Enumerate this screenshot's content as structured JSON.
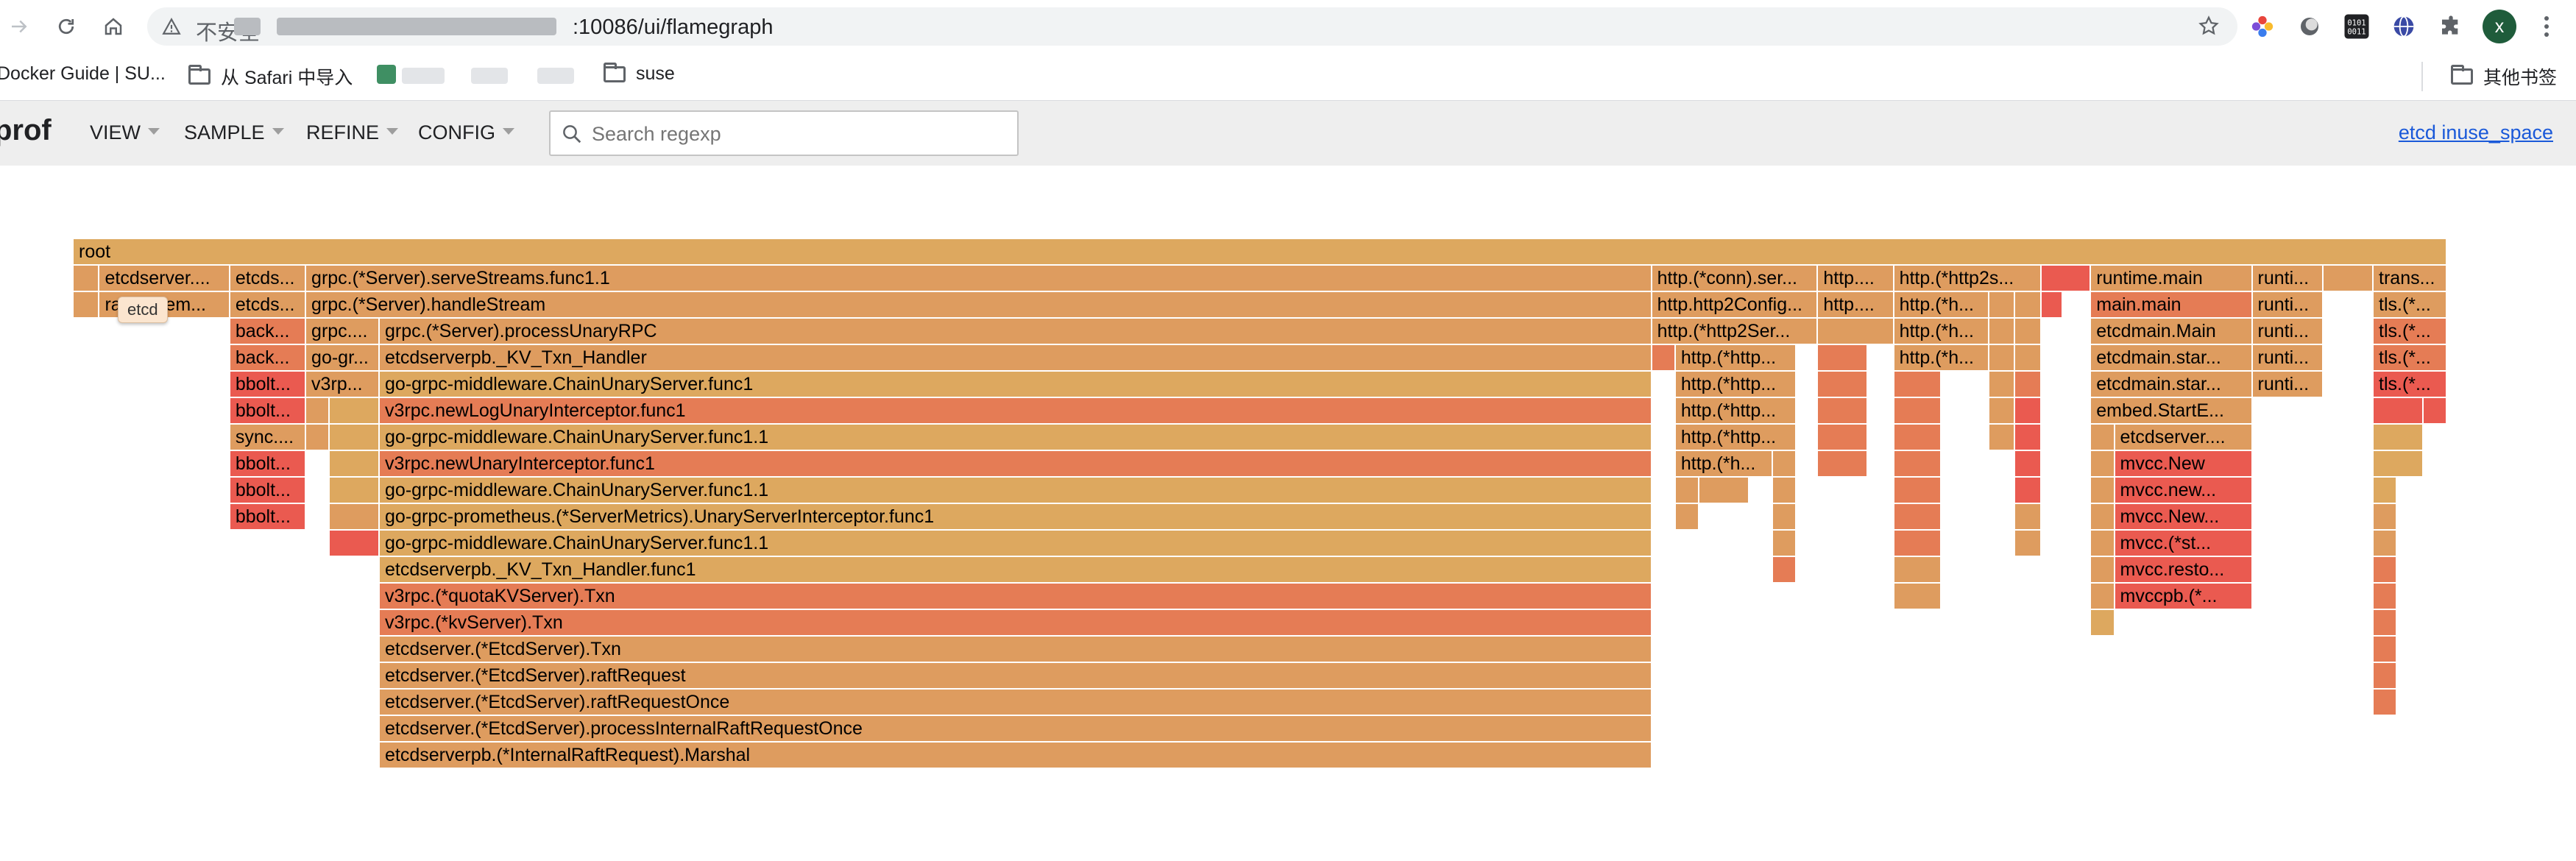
{
  "browser": {
    "insecure_label": "不安全",
    "url_suffix": ":10086/ui/flamegraph",
    "avatar_letter": "x"
  },
  "bookmarks": {
    "items": [
      "Docker Guide | SU...",
      "从 Safari 中导入",
      "suse"
    ],
    "other": "其他书签"
  },
  "pprof": {
    "logo": "prof",
    "menus": [
      "VIEW",
      "SAMPLE",
      "REFINE",
      "CONFIG"
    ],
    "search_placeholder": "Search regexp",
    "profile_link": "etcd inuse_space"
  },
  "tooltip": "etcd",
  "colors": {
    "tan": "#dda85f",
    "orange": "#de9c5f",
    "dark_orange": "#e57c55",
    "red": "#ea5a50",
    "link": "#1a59d9"
  },
  "flamegraph": {
    "frames": [
      {
        "d": 0,
        "s": 0,
        "e": 1000,
        "t": "root",
        "c": "tan"
      },
      {
        "d": 1,
        "s": 0,
        "e": 11,
        "t": "",
        "c": "orange"
      },
      {
        "d": 1,
        "s": 11,
        "e": 66,
        "t": "etcdserver....",
        "c": "orange"
      },
      {
        "d": 1,
        "s": 66,
        "e": 98,
        "t": "etcds...",
        "c": "orange"
      },
      {
        "d": 1,
        "s": 98,
        "e": 665,
        "t": "grpc.(*Server).serveStreams.func1.1",
        "c": "orange"
      },
      {
        "d": 1,
        "s": 665,
        "e": 735,
        "t": "http.(*conn).ser...",
        "c": "orange"
      },
      {
        "d": 1,
        "s": 735,
        "e": 767,
        "t": "http....",
        "c": "orange"
      },
      {
        "d": 1,
        "s": 767,
        "e": 829,
        "t": "http.(*http2s...",
        "c": "orange"
      },
      {
        "d": 1,
        "s": 829,
        "e": 850,
        "t": "",
        "c": "red"
      },
      {
        "d": 1,
        "s": 850,
        "e": 918,
        "t": "runtime.main",
        "c": "orange"
      },
      {
        "d": 1,
        "s": 918,
        "e": 948,
        "t": "runti...",
        "c": "orange"
      },
      {
        "d": 1,
        "s": 948,
        "e": 969,
        "t": "",
        "c": "orange"
      },
      {
        "d": 1,
        "s": 969,
        "e": 1000,
        "t": "trans...",
        "c": "orange"
      },
      {
        "d": 2,
        "s": 0,
        "e": 11,
        "t": "",
        "c": "orange"
      },
      {
        "d": 2,
        "s": 11,
        "e": 66,
        "t": "raft.(*mem...",
        "c": "orange"
      },
      {
        "d": 2,
        "s": 66,
        "e": 98,
        "t": "etcds...",
        "c": "orange"
      },
      {
        "d": 2,
        "s": 98,
        "e": 665,
        "t": "grpc.(*Server).handleStream",
        "c": "orange"
      },
      {
        "d": 2,
        "s": 665,
        "e": 735,
        "t": "http.http2Config...",
        "c": "orange"
      },
      {
        "d": 2,
        "s": 735,
        "e": 767,
        "t": "http....",
        "c": "orange"
      },
      {
        "d": 2,
        "s": 767,
        "e": 807,
        "t": "http.(*h...",
        "c": "orange"
      },
      {
        "d": 2,
        "s": 807,
        "e": 818,
        "t": "",
        "c": "orange"
      },
      {
        "d": 2,
        "s": 818,
        "e": 829,
        "t": "",
        "c": "orange"
      },
      {
        "d": 2,
        "s": 829,
        "e": 838,
        "t": "",
        "c": "red"
      },
      {
        "d": 2,
        "s": 850,
        "e": 918,
        "t": "main.main",
        "c": "dark_orange"
      },
      {
        "d": 2,
        "s": 918,
        "e": 948,
        "t": "runti...",
        "c": "orange"
      },
      {
        "d": 2,
        "s": 969,
        "e": 1000,
        "t": "tls.(*...",
        "c": "orange"
      },
      {
        "d": 3,
        "s": 66,
        "e": 98,
        "t": "back...",
        "c": "dark_orange"
      },
      {
        "d": 3,
        "s": 98,
        "e": 129,
        "t": "grpc....",
        "c": "orange"
      },
      {
        "d": 3,
        "s": 129,
        "e": 665,
        "t": "grpc.(*Server).processUnaryRPC",
        "c": "orange"
      },
      {
        "d": 3,
        "s": 665,
        "e": 735,
        "t": "http.(*http2Ser...",
        "c": "orange"
      },
      {
        "d": 3,
        "s": 735,
        "e": 767,
        "t": "",
        "c": "orange"
      },
      {
        "d": 3,
        "s": 767,
        "e": 807,
        "t": "http.(*h...",
        "c": "orange"
      },
      {
        "d": 3,
        "s": 807,
        "e": 818,
        "t": "",
        "c": "orange"
      },
      {
        "d": 3,
        "s": 818,
        "e": 829,
        "t": "",
        "c": "orange"
      },
      {
        "d": 3,
        "s": 850,
        "e": 918,
        "t": "etcdmain.Main",
        "c": "orange"
      },
      {
        "d": 3,
        "s": 918,
        "e": 948,
        "t": "runti...",
        "c": "orange"
      },
      {
        "d": 3,
        "s": 969,
        "e": 1000,
        "t": "tls.(*...",
        "c": "dark_orange"
      },
      {
        "d": 4,
        "s": 66,
        "e": 98,
        "t": "back...",
        "c": "dark_orange"
      },
      {
        "d": 4,
        "s": 98,
        "e": 129,
        "t": "go-gr...",
        "c": "orange"
      },
      {
        "d": 4,
        "s": 129,
        "e": 665,
        "t": "etcdserverpb._KV_Txn_Handler",
        "c": "orange"
      },
      {
        "d": 4,
        "s": 665,
        "e": 675,
        "t": "",
        "c": "dark_orange"
      },
      {
        "d": 4,
        "s": 675,
        "e": 726,
        "t": "http.(*http...",
        "c": "orange"
      },
      {
        "d": 4,
        "s": 735,
        "e": 756,
        "t": "",
        "c": "dark_orange"
      },
      {
        "d": 4,
        "s": 767,
        "e": 807,
        "t": "http.(*h...",
        "c": "orange"
      },
      {
        "d": 4,
        "s": 807,
        "e": 818,
        "t": "",
        "c": "orange"
      },
      {
        "d": 4,
        "s": 818,
        "e": 829,
        "t": "",
        "c": "orange"
      },
      {
        "d": 4,
        "s": 850,
        "e": 918,
        "t": "etcdmain.star...",
        "c": "orange"
      },
      {
        "d": 4,
        "s": 918,
        "e": 948,
        "t": "runti...",
        "c": "orange"
      },
      {
        "d": 4,
        "s": 969,
        "e": 1000,
        "t": "tls.(*...",
        "c": "dark_orange"
      },
      {
        "d": 5,
        "s": 66,
        "e": 98,
        "t": "bbolt...",
        "c": "red"
      },
      {
        "d": 5,
        "s": 98,
        "e": 129,
        "t": "v3rp...",
        "c": "orange"
      },
      {
        "d": 5,
        "s": 129,
        "e": 665,
        "t": "go-grpc-middleware.ChainUnaryServer.func1",
        "c": "tan"
      },
      {
        "d": 5,
        "s": 675,
        "e": 726,
        "t": "http.(*http...",
        "c": "orange"
      },
      {
        "d": 5,
        "s": 735,
        "e": 756,
        "t": "",
        "c": "dark_orange"
      },
      {
        "d": 5,
        "s": 767,
        "e": 787,
        "t": "",
        "c": "dark_orange"
      },
      {
        "d": 5,
        "s": 807,
        "e": 818,
        "t": "",
        "c": "orange"
      },
      {
        "d": 5,
        "s": 818,
        "e": 829,
        "t": "",
        "c": "dark_orange"
      },
      {
        "d": 5,
        "s": 850,
        "e": 918,
        "t": "etcdmain.star...",
        "c": "orange"
      },
      {
        "d": 5,
        "s": 918,
        "e": 948,
        "t": "runti...",
        "c": "orange"
      },
      {
        "d": 5,
        "s": 969,
        "e": 1000,
        "t": "tls.(*...",
        "c": "red"
      },
      {
        "d": 6,
        "s": 66,
        "e": 98,
        "t": "bbolt...",
        "c": "red"
      },
      {
        "d": 6,
        "s": 98,
        "e": 108,
        "t": "",
        "c": "orange"
      },
      {
        "d": 6,
        "s": 108,
        "e": 129,
        "t": "",
        "c": "tan"
      },
      {
        "d": 6,
        "s": 129,
        "e": 665,
        "t": "v3rpc.newLogUnaryInterceptor.func1",
        "c": "dark_orange"
      },
      {
        "d": 6,
        "s": 675,
        "e": 726,
        "t": "http.(*http...",
        "c": "orange"
      },
      {
        "d": 6,
        "s": 735,
        "e": 756,
        "t": "",
        "c": "dark_orange"
      },
      {
        "d": 6,
        "s": 767,
        "e": 787,
        "t": "",
        "c": "dark_orange"
      },
      {
        "d": 6,
        "s": 807,
        "e": 818,
        "t": "",
        "c": "orange"
      },
      {
        "d": 6,
        "s": 818,
        "e": 829,
        "t": "",
        "c": "red"
      },
      {
        "d": 6,
        "s": 850,
        "e": 918,
        "t": "embed.StartE...",
        "c": "orange"
      },
      {
        "d": 6,
        "s": 969,
        "e": 990,
        "t": "",
        "c": "red"
      },
      {
        "d": 6,
        "s": 990,
        "e": 1000,
        "t": "",
        "c": "red"
      },
      {
        "d": 7,
        "s": 66,
        "e": 98,
        "t": "sync....",
        "c": "orange"
      },
      {
        "d": 7,
        "s": 98,
        "e": 108,
        "t": "",
        "c": "orange"
      },
      {
        "d": 7,
        "s": 108,
        "e": 129,
        "t": "",
        "c": "tan"
      },
      {
        "d": 7,
        "s": 129,
        "e": 665,
        "t": "go-grpc-middleware.ChainUnaryServer.func1.1",
        "c": "tan"
      },
      {
        "d": 7,
        "s": 675,
        "e": 726,
        "t": "http.(*http...",
        "c": "orange"
      },
      {
        "d": 7,
        "s": 735,
        "e": 756,
        "t": "",
        "c": "dark_orange"
      },
      {
        "d": 7,
        "s": 767,
        "e": 787,
        "t": "",
        "c": "dark_orange"
      },
      {
        "d": 7,
        "s": 807,
        "e": 818,
        "t": "",
        "c": "orange"
      },
      {
        "d": 7,
        "s": 818,
        "e": 829,
        "t": "",
        "c": "red"
      },
      {
        "d": 7,
        "s": 850,
        "e": 860,
        "t": "",
        "c": "orange"
      },
      {
        "d": 7,
        "s": 860,
        "e": 918,
        "t": "etcdserver....",
        "c": "orange"
      },
      {
        "d": 7,
        "s": 969,
        "e": 990,
        "t": "",
        "c": "tan"
      },
      {
        "d": 8,
        "s": 66,
        "e": 98,
        "t": "bbolt...",
        "c": "red"
      },
      {
        "d": 8,
        "s": 108,
        "e": 129,
        "t": "",
        "c": "tan"
      },
      {
        "d": 8,
        "s": 129,
        "e": 665,
        "t": "v3rpc.newUnaryInterceptor.func1",
        "c": "dark_orange"
      },
      {
        "d": 8,
        "s": 675,
        "e": 716,
        "t": "http.(*h...",
        "c": "orange"
      },
      {
        "d": 8,
        "s": 716,
        "e": 726,
        "t": "",
        "c": "orange"
      },
      {
        "d": 8,
        "s": 735,
        "e": 756,
        "t": "",
        "c": "dark_orange"
      },
      {
        "d": 8,
        "s": 767,
        "e": 787,
        "t": "",
        "c": "dark_orange"
      },
      {
        "d": 8,
        "s": 818,
        "e": 829,
        "t": "",
        "c": "red"
      },
      {
        "d": 8,
        "s": 850,
        "e": 860,
        "t": "",
        "c": "orange"
      },
      {
        "d": 8,
        "s": 860,
        "e": 918,
        "t": "mvcc.New",
        "c": "red"
      },
      {
        "d": 8,
        "s": 969,
        "e": 990,
        "t": "",
        "c": "tan"
      },
      {
        "d": 9,
        "s": 66,
        "e": 98,
        "t": "bbolt...",
        "c": "red"
      },
      {
        "d": 9,
        "s": 108,
        "e": 129,
        "t": "",
        "c": "tan"
      },
      {
        "d": 9,
        "s": 129,
        "e": 665,
        "t": "go-grpc-middleware.ChainUnaryServer.func1.1",
        "c": "tan"
      },
      {
        "d": 9,
        "s": 675,
        "e": 685,
        "t": "",
        "c": "orange"
      },
      {
        "d": 9,
        "s": 685,
        "e": 706,
        "t": "",
        "c": "orange"
      },
      {
        "d": 9,
        "s": 716,
        "e": 726,
        "t": "",
        "c": "orange"
      },
      {
        "d": 9,
        "s": 767,
        "e": 787,
        "t": "",
        "c": "dark_orange"
      },
      {
        "d": 9,
        "s": 818,
        "e": 829,
        "t": "",
        "c": "red"
      },
      {
        "d": 9,
        "s": 850,
        "e": 860,
        "t": "",
        "c": "orange"
      },
      {
        "d": 9,
        "s": 860,
        "e": 918,
        "t": "mvcc.new...",
        "c": "red"
      },
      {
        "d": 9,
        "s": 969,
        "e": 979,
        "t": "",
        "c": "tan"
      },
      {
        "d": 10,
        "s": 66,
        "e": 98,
        "t": "bbolt...",
        "c": "red"
      },
      {
        "d": 10,
        "s": 108,
        "e": 129,
        "t": "",
        "c": "orange"
      },
      {
        "d": 10,
        "s": 129,
        "e": 665,
        "t": "go-grpc-prometheus.(*ServerMetrics).UnaryServerInterceptor.func1",
        "c": "tan"
      },
      {
        "d": 10,
        "s": 675,
        "e": 685,
        "t": "",
        "c": "orange"
      },
      {
        "d": 10,
        "s": 716,
        "e": 726,
        "t": "",
        "c": "orange"
      },
      {
        "d": 10,
        "s": 767,
        "e": 787,
        "t": "",
        "c": "dark_orange"
      },
      {
        "d": 10,
        "s": 818,
        "e": 829,
        "t": "",
        "c": "orange"
      },
      {
        "d": 10,
        "s": 850,
        "e": 860,
        "t": "",
        "c": "orange"
      },
      {
        "d": 10,
        "s": 860,
        "e": 918,
        "t": "mvcc.New...",
        "c": "red"
      },
      {
        "d": 10,
        "s": 969,
        "e": 979,
        "t": "",
        "c": "orange"
      },
      {
        "d": 11,
        "s": 108,
        "e": 129,
        "t": "",
        "c": "red"
      },
      {
        "d": 11,
        "s": 129,
        "e": 665,
        "t": "go-grpc-middleware.ChainUnaryServer.func1.1",
        "c": "tan"
      },
      {
        "d": 11,
        "s": 716,
        "e": 726,
        "t": "",
        "c": "orange"
      },
      {
        "d": 11,
        "s": 767,
        "e": 787,
        "t": "",
        "c": "dark_orange"
      },
      {
        "d": 11,
        "s": 818,
        "e": 829,
        "t": "",
        "c": "orange"
      },
      {
        "d": 11,
        "s": 850,
        "e": 860,
        "t": "",
        "c": "orange"
      },
      {
        "d": 11,
        "s": 860,
        "e": 918,
        "t": "mvcc.(*st...",
        "c": "red"
      },
      {
        "d": 11,
        "s": 969,
        "e": 979,
        "t": "",
        "c": "orange"
      },
      {
        "d": 12,
        "s": 129,
        "e": 665,
        "t": "etcdserverpb._KV_Txn_Handler.func1",
        "c": "tan"
      },
      {
        "d": 12,
        "s": 716,
        "e": 726,
        "t": "",
        "c": "dark_orange"
      },
      {
        "d": 12,
        "s": 767,
        "e": 787,
        "t": "",
        "c": "orange"
      },
      {
        "d": 12,
        "s": 850,
        "e": 860,
        "t": "",
        "c": "orange"
      },
      {
        "d": 12,
        "s": 860,
        "e": 918,
        "t": "mvcc.resto...",
        "c": "red"
      },
      {
        "d": 12,
        "s": 969,
        "e": 979,
        "t": "",
        "c": "dark_orange"
      },
      {
        "d": 13,
        "s": 129,
        "e": 665,
        "t": "v3rpc.(*quotaKVServer).Txn",
        "c": "dark_orange"
      },
      {
        "d": 13,
        "s": 767,
        "e": 787,
        "t": "",
        "c": "orange"
      },
      {
        "d": 13,
        "s": 850,
        "e": 860,
        "t": "",
        "c": "orange"
      },
      {
        "d": 13,
        "s": 860,
        "e": 918,
        "t": "mvccpb.(*...",
        "c": "red"
      },
      {
        "d": 13,
        "s": 969,
        "e": 979,
        "t": "",
        "c": "dark_orange"
      },
      {
        "d": 14,
        "s": 129,
        "e": 665,
        "t": "v3rpc.(*kvServer).Txn",
        "c": "dark_orange"
      },
      {
        "d": 14,
        "s": 850,
        "e": 860,
        "t": "",
        "c": "tan"
      },
      {
        "d": 14,
        "s": 969,
        "e": 979,
        "t": "",
        "c": "dark_orange"
      },
      {
        "d": 15,
        "s": 129,
        "e": 665,
        "t": "etcdserver.(*EtcdServer).Txn",
        "c": "orange"
      },
      {
        "d": 15,
        "s": 969,
        "e": 979,
        "t": "",
        "c": "dark_orange"
      },
      {
        "d": 16,
        "s": 129,
        "e": 665,
        "t": "etcdserver.(*EtcdServer).raftRequest",
        "c": "orange"
      },
      {
        "d": 16,
        "s": 969,
        "e": 979,
        "t": "",
        "c": "dark_orange"
      },
      {
        "d": 17,
        "s": 129,
        "e": 665,
        "t": "etcdserver.(*EtcdServer).raftRequestOnce",
        "c": "orange"
      },
      {
        "d": 17,
        "s": 969,
        "e": 979,
        "t": "",
        "c": "dark_orange"
      },
      {
        "d": 18,
        "s": 129,
        "e": 665,
        "t": "etcdserver.(*EtcdServer).processInternalRaftRequestOnce",
        "c": "orange"
      },
      {
        "d": 19,
        "s": 129,
        "e": 665,
        "t": "etcdserverpb.(*InternalRaftRequest).Marshal",
        "c": "orange"
      }
    ]
  }
}
